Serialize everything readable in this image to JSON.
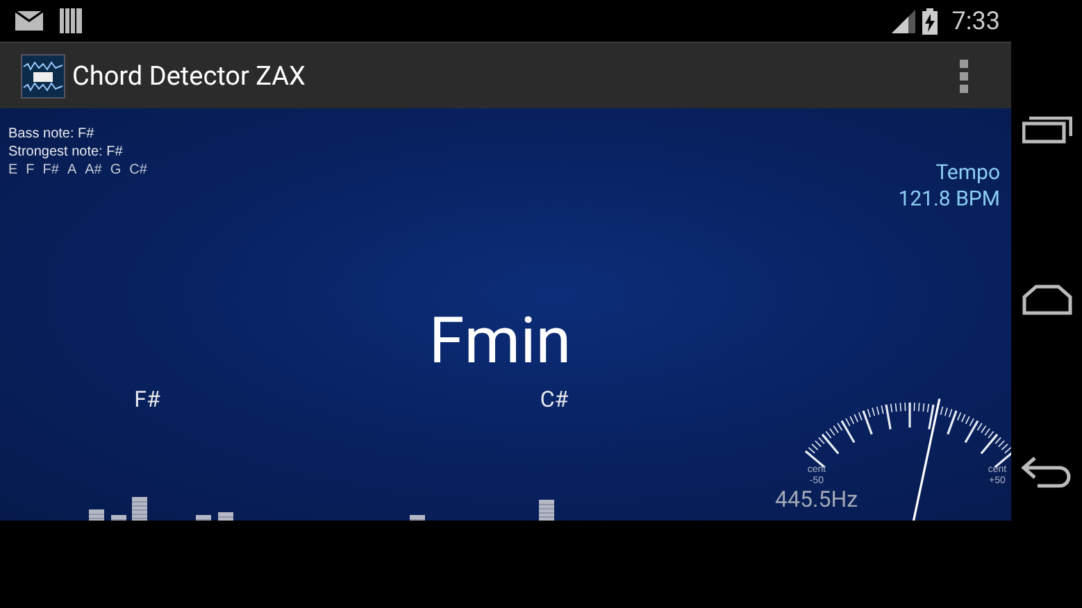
{
  "status_bar": {
    "time": "7:33"
  },
  "action_bar": {
    "title": "Chord Detector ZAX"
  },
  "info": {
    "bass_note": "Bass note: F#",
    "strongest_note": "Strongest note: F#",
    "notes": [
      "E",
      "F",
      "F#",
      "A",
      "A#",
      "G",
      "C#"
    ]
  },
  "tempo": {
    "label": "Tempo",
    "value": "121.8 BPM"
  },
  "chord": "Fmin",
  "chord_notes": [
    {
      "label": "F#"
    },
    {
      "label": "C#"
    }
  ],
  "tuner": {
    "frequency": "445.5Hz",
    "scale_labels": [
      {
        "unit": "cent",
        "value": "-50"
      },
      {
        "unit": "cent",
        "value": "+50"
      }
    ]
  }
}
